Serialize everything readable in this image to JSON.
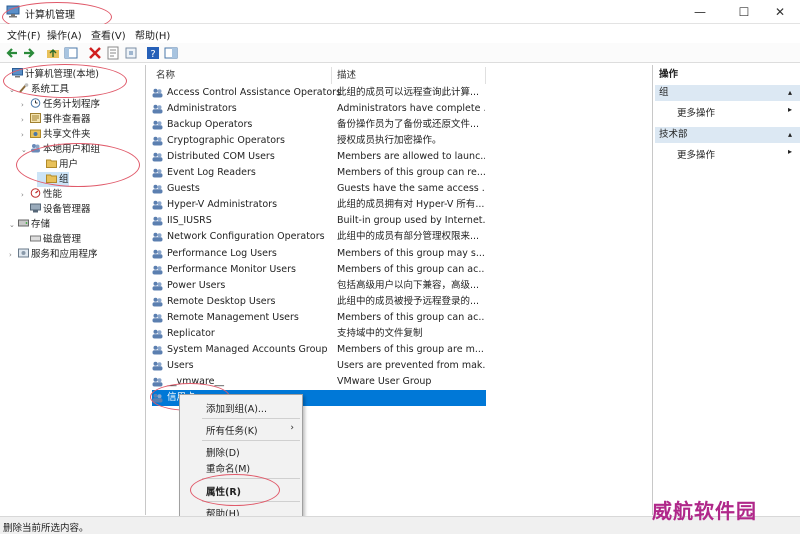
{
  "window": {
    "title": "计算机管理",
    "minimize": "—",
    "maximize": "☐",
    "close": "✕"
  },
  "menu": [
    "文件(F)",
    "操作(A)",
    "查看(V)",
    "帮助(H)"
  ],
  "tree": [
    {
      "label": "计算机管理(本地)",
      "toggle": "",
      "icon": "computer"
    },
    {
      "label": "系统工具",
      "toggle": "⌄",
      "icon": "tools"
    },
    {
      "label": "任务计划程序",
      "toggle": "›",
      "icon": "clock"
    },
    {
      "label": "事件查看器",
      "toggle": "›",
      "icon": "event"
    },
    {
      "label": "共享文件夹",
      "toggle": "›",
      "icon": "share"
    },
    {
      "label": "本地用户和组",
      "toggle": "⌄",
      "icon": "users"
    },
    {
      "label": "用户",
      "toggle": "",
      "icon": "folder"
    },
    {
      "label": "组",
      "toggle": "",
      "icon": "folder"
    },
    {
      "label": "性能",
      "toggle": "›",
      "icon": "perf"
    },
    {
      "label": "设备管理器",
      "toggle": "",
      "icon": "device"
    },
    {
      "label": "存储",
      "toggle": "⌄",
      "icon": "storage"
    },
    {
      "label": "磁盘管理",
      "toggle": "",
      "icon": "disk"
    },
    {
      "label": "服务和应用程序",
      "toggle": "›",
      "icon": "services"
    }
  ],
  "columns": {
    "name": "名称",
    "desc": "描述"
  },
  "groups": [
    {
      "name": "Access Control Assistance Operators",
      "desc": "此组的成员可以远程查询此计算..."
    },
    {
      "name": "Administrators",
      "desc": "Administrators have complete ..."
    },
    {
      "name": "Backup Operators",
      "desc": "备份操作员为了备份或还原文件..."
    },
    {
      "name": "Cryptographic Operators",
      "desc": "授权成员执行加密操作。"
    },
    {
      "name": "Distributed COM Users",
      "desc": "Members are allowed to launc..."
    },
    {
      "name": "Event Log Readers",
      "desc": "Members of this group can re..."
    },
    {
      "name": "Guests",
      "desc": "Guests have the same access ..."
    },
    {
      "name": "Hyper-V Administrators",
      "desc": "此组的成员拥有对 Hyper-V 所有..."
    },
    {
      "name": "IIS_IUSRS",
      "desc": "Built-in group used by Internet..."
    },
    {
      "name": "Network Configuration Operators",
      "desc": "此组中的成员有部分管理权限来..."
    },
    {
      "name": "Performance Log Users",
      "desc": "Members of this group may s..."
    },
    {
      "name": "Performance Monitor Users",
      "desc": "Members of this group can ac..."
    },
    {
      "name": "Power Users",
      "desc": "包括高级用户以向下兼容，高级..."
    },
    {
      "name": "Remote Desktop Users",
      "desc": "此组中的成员被授予远程登录的..."
    },
    {
      "name": "Remote Management Users",
      "desc": "Members of this group can ac..."
    },
    {
      "name": "Replicator",
      "desc": "支持域中的文件复制"
    },
    {
      "name": "System Managed Accounts Group",
      "desc": "Members of this group are m..."
    },
    {
      "name": "Users",
      "desc": "Users are prevented from mak..."
    },
    {
      "name": "__vmware__",
      "desc": "VMware User Group"
    },
    {
      "name": "信用卡",
      "desc": ""
    }
  ],
  "context_menu": {
    "add_to_group": "添加到组(A)...",
    "all_tasks": "所有任务(K)",
    "all_tasks_arrow": "›",
    "delete": "删除(D)",
    "rename": "重命名(M)",
    "properties": "属性(R)",
    "help": "帮助(H)"
  },
  "actions": {
    "header": "操作",
    "section1": "组",
    "section1_more": "更多操作",
    "section2": "技术部",
    "section2_more": "更多操作",
    "collapse_arrow": "▴",
    "more_arrow": "▸"
  },
  "status": "删除当前所选内容。",
  "watermark": "威航软件园",
  "colors": {
    "selection": "#0078d7",
    "annotation": "#e05a6a",
    "watermark": "#b0288a"
  }
}
